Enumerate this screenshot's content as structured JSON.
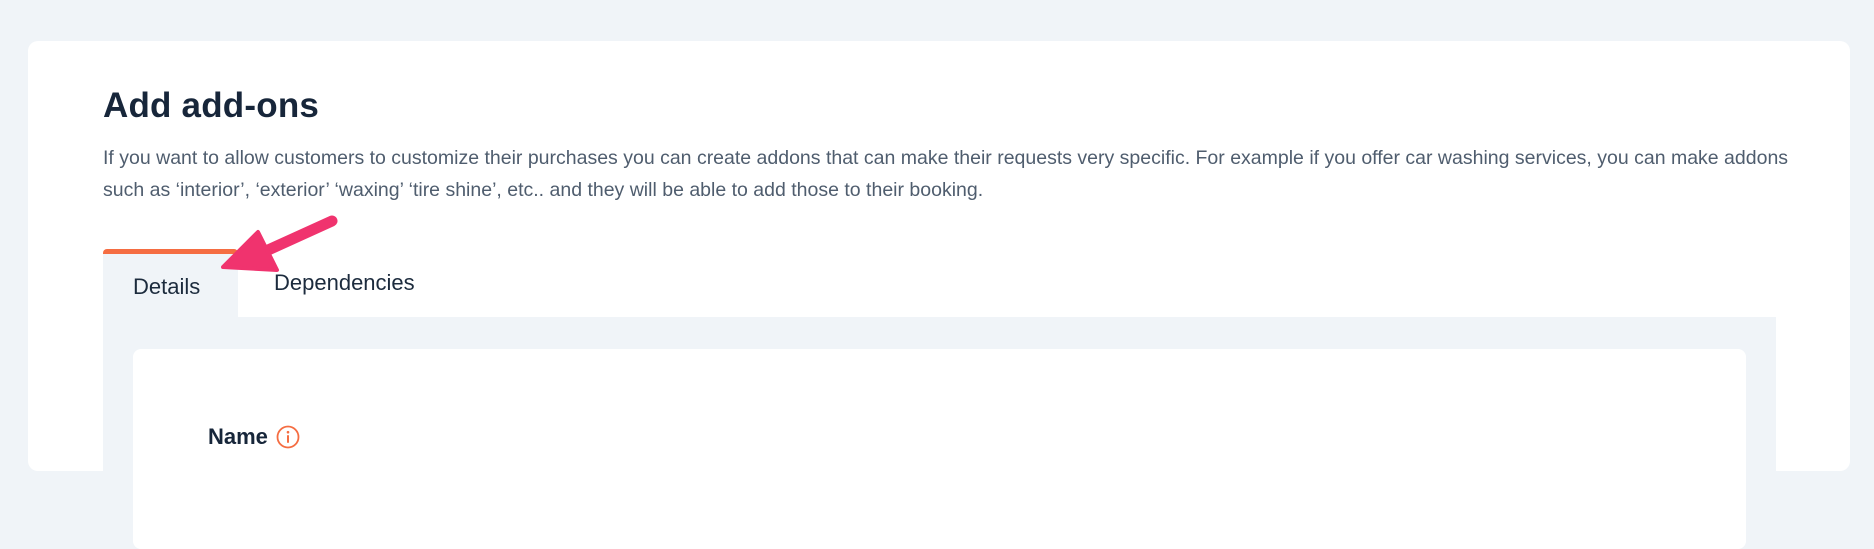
{
  "page": {
    "title": "Add add-ons",
    "description": "If you want to allow customers to customize their purchases you can create addons that can make their requests very specific. For example if you offer car washing services, you can make addons such as ‘interior’, ‘exterior’ ‘waxing’ ‘tire shine’, etc.. and they will be able to add those to their booking."
  },
  "tabs": [
    {
      "label": "Details",
      "active": true
    },
    {
      "label": "Dependencies",
      "active": false
    }
  ],
  "form": {
    "name_label": "Name"
  },
  "icons": {
    "info": "info-icon",
    "annotation": "arrow-annotation"
  },
  "colors": {
    "accent": "#f56d42",
    "annotation_arrow": "#f0336e",
    "background": "#f0f4f8"
  }
}
